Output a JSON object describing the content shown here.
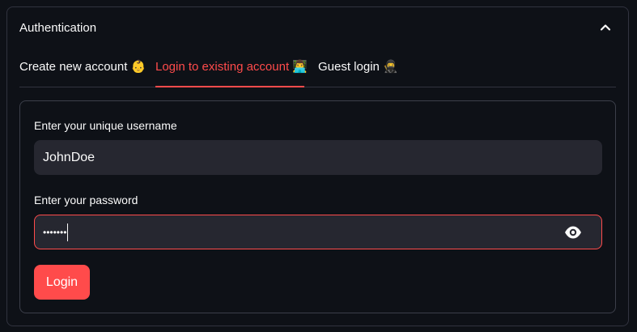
{
  "expander": {
    "title": "Authentication"
  },
  "tabs": [
    {
      "label": "Create new account 👶",
      "active": false
    },
    {
      "label": "Login to existing account 👨‍💻",
      "active": true
    },
    {
      "label": "Guest login 🥷",
      "active": false
    }
  ],
  "form": {
    "username_label": "Enter your unique username",
    "username_value": "JohnDoe",
    "password_label": "Enter your password",
    "password_value": "•••••••",
    "login_label": "Login"
  },
  "colors": {
    "accent": "#ff4b4b",
    "background": "#0e1117",
    "input_bg": "#262730"
  },
  "icons": {
    "collapse": "chevron-up-icon",
    "show_password": "eye-icon"
  }
}
